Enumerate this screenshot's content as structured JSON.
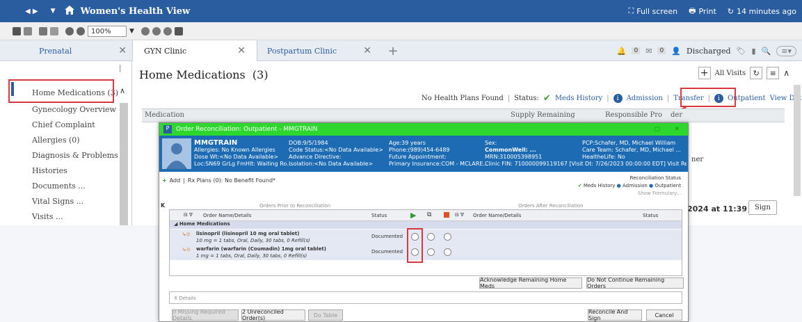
{
  "app": {
    "title": "Women's Health View",
    "fullscreen_label": "Full screen",
    "print_label": "Print",
    "refresh_label": "14 minutes ago"
  },
  "toolbar": {
    "zoom": "100%"
  },
  "tabs": [
    {
      "label": "Prenatal"
    },
    {
      "label": "GYN Clinic"
    },
    {
      "label": "Postpartum Clinic"
    }
  ],
  "tabs_right": {
    "discharged_label": "Discharged"
  },
  "sidebar": {
    "items": [
      {
        "label": "Home Medications (3)"
      },
      {
        "label": "Gynecology Overview"
      },
      {
        "label": "Chief Complaint"
      },
      {
        "label": "Allergies (0)"
      },
      {
        "label": "Diagnosis & Problems"
      },
      {
        "label": "Histories"
      },
      {
        "label": "Documents ..."
      },
      {
        "label": "Vital Signs ..."
      },
      {
        "label": "Visits ..."
      }
    ]
  },
  "main": {
    "title": "Home Medications  (3)",
    "all_visits_label": "All Visits",
    "no_health_plans": "No Health Plans Found",
    "status_label": "Status:",
    "meds_history": "Meds History",
    "admission": "Admission",
    "transfer": "Transfer",
    "outpatient": "Outpatient",
    "view_details": "View Details",
    "col_medication": "Medication",
    "col_supply": "Supply Remaining",
    "col_provider": "Responsible Pro",
    "col_provider_tail": "der",
    "date_text": "2024 at 11:39",
    "sign_label": "Sign",
    "ner_text": "ner"
  },
  "dialog": {
    "title": "Order Reconciliation: Outpatient - MMGTRAIN",
    "patient": {
      "name": "MMGTRAIN",
      "allergies": "Allergies: No Known Allergies",
      "dose_wt": "Dose Wt:<No Data Available>",
      "isolation_loc": "Loc:SN69 GrLg FmHlt: Waiting Ro...",
      "dob": "DOB:9/5/1984",
      "code_status": "Code Status:<No Data Available>",
      "advance_directive": "Advance Directive:",
      "isolation": "Isolation:<No Data Available>",
      "age": "Age:39 years",
      "phone": "Phone:(989)454-6489",
      "future_appt": "Future Appointment:",
      "primary_ins": "Primary Insurance:COM - MCLARE...",
      "sex": "Sex:",
      "commonwell": "CommonWell: ...",
      "mrn": "MRN:310005398951",
      "clinic_fin": "Clinic FIN: 710000099119167 [Visit Dt: 7/26/2023 00:00:00 EDT] Visit Re...",
      "pcp": "PCP:Schafer, MD, Michael William",
      "care_team": "Care Team: Schafer, MD, Michael ...",
      "healthelife": "HealtheLife: No"
    },
    "add_label": "Add",
    "rx_plans": "Rx Plans (0): No Benefit Found*",
    "recon_status_label": "Reconciliation Status",
    "recon_meds_history": "Meds History",
    "recon_admission": "Admission",
    "recon_outpatient": "Outpatient",
    "show_formulary": "Show Formulary...",
    "orders_prior": "Orders Prior to Reconciliation",
    "orders_after": "Orders After Reconciliation",
    "col_order_name": "Order Name/Details",
    "col_status": "Status",
    "col_order_name_after": "Order Name/Details",
    "col_status_after": "Status",
    "group_label": "Home Medications",
    "meds": [
      {
        "name": "lisinopril (lisinopril 10 mg oral tablet)",
        "details": "10 mg = 1 tabs, Oral, Daily, 30 tabs, 0 Refill(s)",
        "status": "Documented"
      },
      {
        "name": "warfarin (warfarin (Coumadin) 1mg oral tablet)",
        "details": "1 mg = 1 tabs, Oral, Daily, 30 tabs, 0 Refill(s)",
        "status": "Documented"
      }
    ],
    "ack_button": "Acknowledge Remaining Home Meds",
    "dnc_button": "Do Not Continue Remaining Orders",
    "details_label": "Details",
    "missing_btn": "0 Missing Required Details",
    "unreconciled_btn": "2 Unreconciled Order(s)",
    "dotable_btn": "Do Table",
    "reconcile_sign": "Reconcile And Sign",
    "cancel": "Cancel"
  },
  "colors": {
    "header_blue": "#2a5d9f",
    "banner_blue": "#1c6bb3",
    "title_green": "#2ed72e",
    "highlight_red": "#d9363e"
  }
}
